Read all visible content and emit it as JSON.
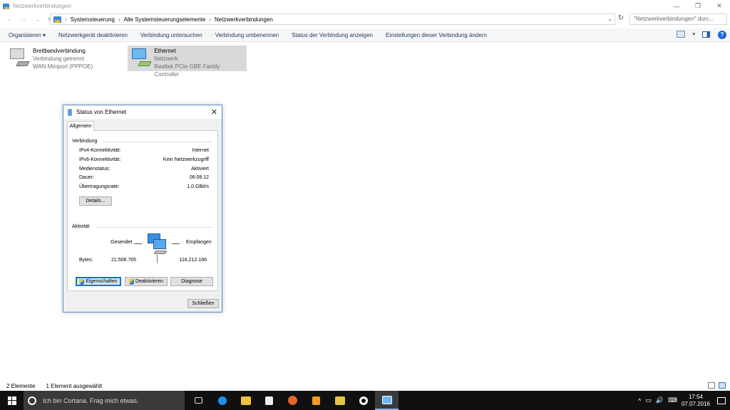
{
  "window": {
    "title": "Netzwerkverbindungen",
    "controls": {
      "minimize": "—",
      "maximize": "❐",
      "close": "✕"
    }
  },
  "address": {
    "back": "←",
    "forward": "→",
    "recent": "⌄",
    "up": "↑",
    "breadcrumbs": [
      "Systemsteuerung",
      "Alle Systemsteuerungselemente",
      "Netzwerkverbindungen"
    ],
    "separator": "›",
    "dropdown": "⌄",
    "refresh": "↻",
    "search_placeholder": "\"Netzwerkverbindungen\" durc..."
  },
  "commandbar": {
    "items": [
      "Organisieren ▾",
      "Netzwerkgerät deaktivieren",
      "Verbindung untersuchen",
      "Verbindung umbenennen",
      "Status der Verbindung anzeigen",
      "Einstellungen dieser Verbindung ändern"
    ],
    "view_caret": "▾",
    "help": "?"
  },
  "connections": [
    {
      "name": "Breitbandverbindung",
      "status": "Verbindung getrennt",
      "device": "WAN Miniport (PPPOE)"
    },
    {
      "name": "Ethernet",
      "status": "Netzwerk",
      "device": "Realtek PCIe GBE Family Controller"
    }
  ],
  "dialog": {
    "title": "Status von Ethernet",
    "close": "✕",
    "tab": "Allgemein",
    "connection_group": "Verbindung",
    "rows": [
      {
        "label": "IPv4-Konnektivität:",
        "value": "Internet"
      },
      {
        "label": "IPv6-Konnektivität:",
        "value": "Kein Netzwerkzugriff"
      },
      {
        "label": "Medienstatus:",
        "value": "Aktiviert"
      },
      {
        "label": "Dauer:",
        "value": "06:08:12"
      },
      {
        "label": "Übertragungsrate:",
        "value": "1,0 GBit/s"
      }
    ],
    "details_button": "Details...",
    "activity_group": "Aktivität",
    "sent_label": "Gesendet",
    "received_label": "Empfangen",
    "bytes_label": "Bytes:",
    "bytes_sent": "21.508.765",
    "bytes_received": "116.212.166",
    "properties_button": "Eigenschaften",
    "deactivate_button": "Deaktivieren",
    "diagnose_button": "Diagnose",
    "close_button": "Schließen"
  },
  "statusbar": {
    "count": "2 Elemente",
    "selected": "1 Element ausgewählt"
  },
  "taskbar": {
    "cortana_text": "Ich bin Cortana. Frag mich etwas.",
    "tray_chevron": "^",
    "tray_sound": "🔊",
    "tray_lang": "⌨",
    "time": "17:54",
    "date": "07.07.2016"
  }
}
